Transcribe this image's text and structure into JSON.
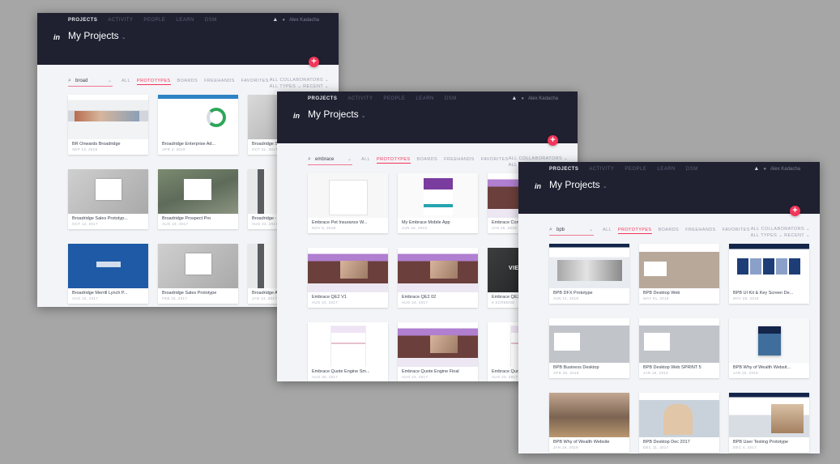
{
  "nav": {
    "items": [
      "PROJECTS",
      "ACTIVITY",
      "PEOPLE",
      "LEARN",
      "DSM"
    ],
    "user": "Alex Kadacha"
  },
  "page_title": "My Projects",
  "filters": {
    "tabs": [
      "ALL",
      "PROTOTYPES",
      "BOARDS",
      "FREEHANDS",
      "FAVORITES"
    ],
    "active_tab": "PROTOTYPES",
    "collaborators": "ALL COLLABORATORS",
    "types": "ALL TYPES",
    "sort": "RECENT"
  },
  "windows": [
    {
      "search": "broad",
      "cards": [
        {
          "name": "BR Onwards Broadridge",
          "date": "SEP 13, 2018",
          "thumb": "t-br1"
        },
        {
          "name": "Broadridge Enterprise Ad...",
          "date": "APR 4, 2018",
          "thumb": "t-br2"
        },
        {
          "name": "Broadridge Sales",
          "date": "OCT 31, 2017",
          "thumb": "t-gray"
        },
        {
          "name": "Broadridge Sales Prototyp...",
          "date": "OCT 14, 2017",
          "thumb": "t-login"
        },
        {
          "name": "Broadridge Prospect Pro",
          "date": "AUG 24, 2017",
          "thumb": "t-city"
        },
        {
          "name": "Broadridge - BAS",
          "date": "AUG 24, 2017",
          "thumb": "t-dark"
        },
        {
          "name": "Broadridge Merrill Lynch P...",
          "date": "AUG 24, 2017",
          "thumb": "t-merrill"
        },
        {
          "name": "Broadridge Sales Prototype",
          "date": "FEB 16, 2017",
          "thumb": "t-login"
        },
        {
          "name": "Broadridge Aspir",
          "date": "JAN 14, 2017",
          "thumb": "t-dark"
        }
      ]
    },
    {
      "search": "embrace",
      "cards": [
        {
          "name": "Embrace Pet Insurance W...",
          "date": "NOV 5, 2018",
          "thumb": "t-form"
        },
        {
          "name": "My Embrace Mobile App",
          "date": "JUN 18, 2018",
          "thumb": "t-mobile"
        },
        {
          "name": "Embrace Conversion",
          "date": "JAN 25, 2018",
          "thumb": "t-purple"
        },
        {
          "name": "Embrace QE2 V1",
          "date": "AUG 24, 2017",
          "thumb": "t-purple"
        },
        {
          "name": "Embrace QE2 02",
          "date": "AUG 24, 2017",
          "thumb": "t-purple"
        },
        {
          "name": "Embrace QE2 01",
          "date": "6 SCREENS",
          "thumb": "t-videobg"
        },
        {
          "name": "Embrace Quote Engine Sm...",
          "date": "AUG 25, 2017",
          "thumb": "t-engine"
        },
        {
          "name": "Embrace Quote Engine Final",
          "date": "AUG 24, 2017",
          "thumb": "t-purple"
        },
        {
          "name": "Embrace Quote Engine",
          "date": "AUG 23, 2017",
          "thumb": "t-engine"
        }
      ]
    },
    {
      "search": "bpb",
      "cards": [
        {
          "name": "BPB DFX Prototype",
          "date": "JUN 14, 2018",
          "thumb": "t-bpbweb"
        },
        {
          "name": "BPB Desktop Web",
          "date": "MAY 01, 2018",
          "thumb": "t-bpbpeople"
        },
        {
          "name": "BPB UI Kit & Key Screen De...",
          "date": "MAY 28, 2018",
          "thumb": "t-bpbkit"
        },
        {
          "name": "BPB Business Desktop",
          "date": "APR 26, 2018",
          "thumb": "t-office"
        },
        {
          "name": "BPB Desktop Web SPRINT 5",
          "date": "JAN 16, 2018",
          "thumb": "t-office"
        },
        {
          "name": "BPB Why of Wealth Websit...",
          "date": "JAN 16, 2018",
          "thumb": "t-bluecard"
        },
        {
          "name": "BPB Why of Wealth Website",
          "date": "JAN 16, 2018",
          "thumb": "t-beach"
        },
        {
          "name": "BPB Desktop Dec 2017",
          "date": "DEC 11, 2017",
          "thumb": "t-smile"
        },
        {
          "name": "BPB User Testing Prototype",
          "date": "DEC 4, 2017",
          "thumb": "t-testing"
        }
      ]
    }
  ]
}
